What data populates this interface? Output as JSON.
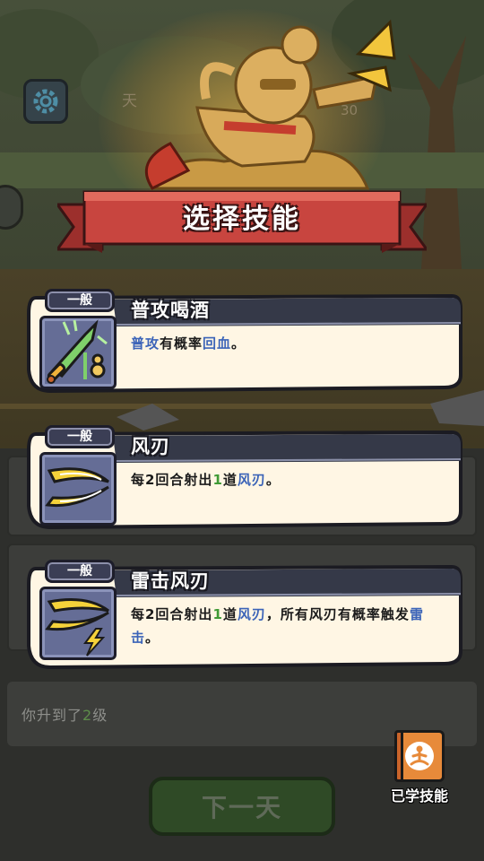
{
  "dialog_title": "选择技能",
  "background": {
    "day_label": "天",
    "coin_text": "30",
    "log_text_prefix": "你升到了",
    "log_level": "2",
    "log_text_suffix": "级",
    "next_day_button": "下一天"
  },
  "learned_skills": {
    "label": "已学技能",
    "icon": "meditation-book-icon"
  },
  "skills": [
    {
      "rarity": "一般",
      "name": "普攻喝酒",
      "icon": "jade-sword-gourd-icon",
      "desc": [
        {
          "t": "普攻",
          "c": "blue"
        },
        {
          "t": "有概率",
          "c": "dark"
        },
        {
          "t": "回血",
          "c": "blue"
        },
        {
          "t": "。",
          "c": "dark"
        }
      ]
    },
    {
      "rarity": "一般",
      "name": "风刃",
      "icon": "wind-blade-icon",
      "desc": [
        {
          "t": "每2回合射出",
          "c": "dark"
        },
        {
          "t": "1",
          "c": "green"
        },
        {
          "t": "道",
          "c": "dark"
        },
        {
          "t": "风刃",
          "c": "blue"
        },
        {
          "t": "。",
          "c": "dark"
        }
      ]
    },
    {
      "rarity": "一般",
      "name": "雷击风刃",
      "icon": "thunder-wind-blade-icon",
      "desc": [
        {
          "t": "每2回合射出",
          "c": "dark"
        },
        {
          "t": "1",
          "c": "green"
        },
        {
          "t": "道",
          "c": "dark"
        },
        {
          "t": "风刃",
          "c": "blue"
        },
        {
          "t": "，所有风刃有概率触发",
          "c": "dark"
        },
        {
          "t": "雷击",
          "c": "blue"
        },
        {
          "t": "。",
          "c": "dark"
        }
      ]
    }
  ],
  "colors": {
    "card_bg": "#fff6e4",
    "card_header": "#353948",
    "ribbon_red": "#c8453f",
    "keyword_blue": "#3c64b8",
    "keyword_green": "#3f9a35",
    "icon_frame": "#656d96"
  }
}
